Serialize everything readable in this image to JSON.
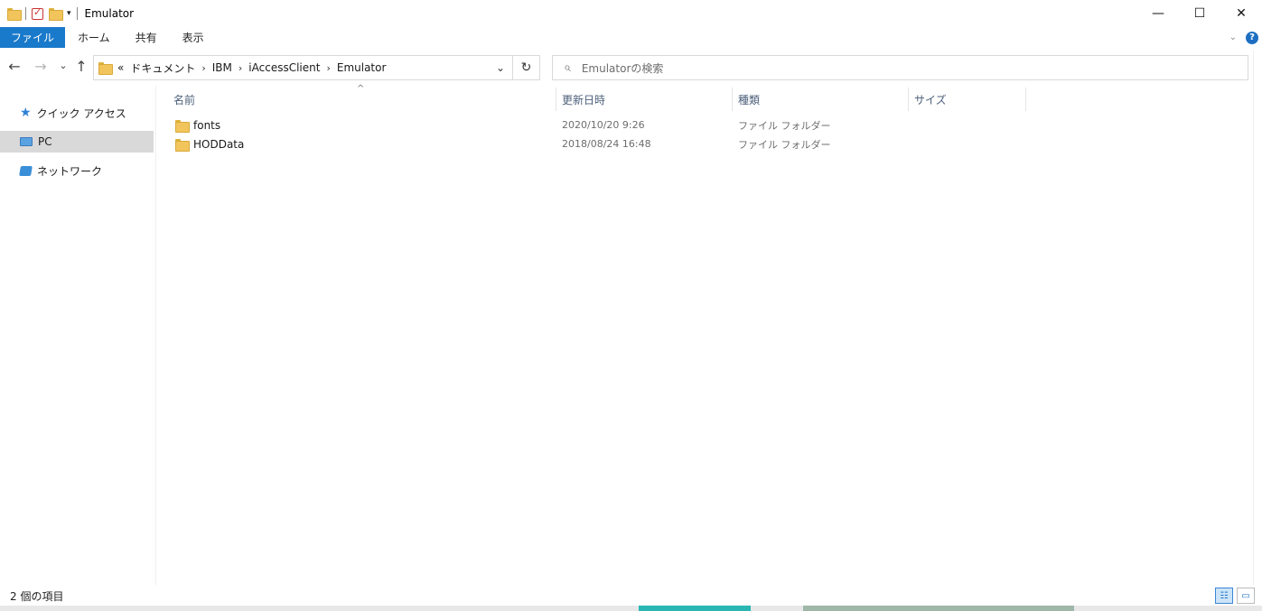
{
  "window": {
    "title": "Emulator",
    "controls": {
      "minimize": "—",
      "maximize": "☐",
      "close": "✕"
    }
  },
  "quick_access": {
    "dropdown_glyph": "▾"
  },
  "ribbon": {
    "tabs": [
      "ファイル",
      "ホーム",
      "共有",
      "表示"
    ],
    "expand_glyph": "⌄",
    "help_glyph": "?"
  },
  "address": {
    "back": "←",
    "forward": "→",
    "recent": "⌄",
    "up": "↑",
    "overflow": "«",
    "crumbs": [
      "ドキュメント",
      "IBM",
      "iAccessClient",
      "Emulator"
    ],
    "crumb_sep": "›",
    "dropdown_glyph": "⌄",
    "refresh_glyph": "↻"
  },
  "search": {
    "placeholder": "Emulatorの検索",
    "icon": "⌕"
  },
  "nav_pane": {
    "items": [
      {
        "label": "クイック アクセス",
        "icon": "star-icon"
      },
      {
        "label": "PC",
        "icon": "pc-icon",
        "selected": true
      },
      {
        "label": "ネットワーク",
        "icon": "network-icon"
      }
    ]
  },
  "columns": {
    "name": "名前",
    "modified": "更新日時",
    "type": "種類",
    "size": "サイズ",
    "sort_glyph": "^"
  },
  "files": [
    {
      "name": "fonts",
      "modified": "2020/10/20 9:26",
      "type": "ファイル フォルダー"
    },
    {
      "name": "HODData",
      "modified": "2018/08/24 16:48",
      "type": "ファイル フォルダー"
    }
  ],
  "status": {
    "item_count": "2 個の項目"
  }
}
